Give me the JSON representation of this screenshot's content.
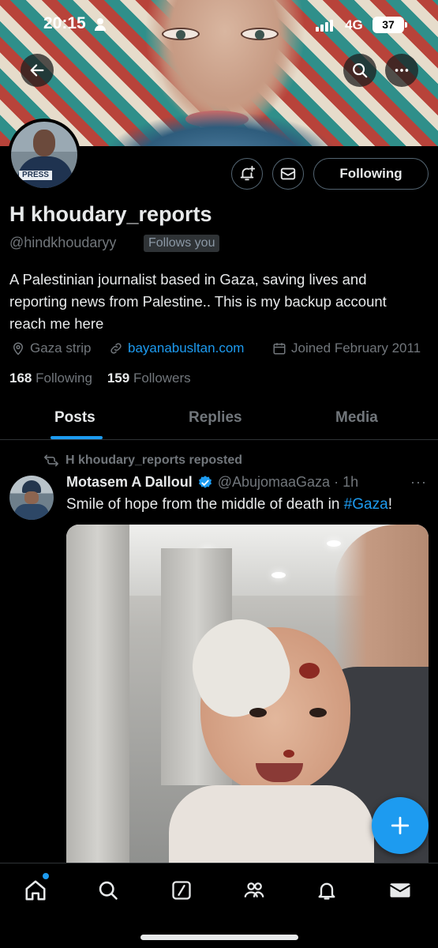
{
  "status_bar": {
    "time": "20:15",
    "network": "4G",
    "battery": "37"
  },
  "profile": {
    "display_name": "H khoudary_reports",
    "handle": "@hindkhoudaryy",
    "follows_you_label": "Follows you",
    "following_button_label": "Following",
    "bio": "A Palestinian journalist based in Gaza, saving lives and reporting news from Palestine.. This is my backup account reach me here",
    "avatar_badge": "PRESS",
    "location": "Gaza strip",
    "website": "bayanabusltan.com",
    "joined": "Joined February 2011",
    "following_count": "168",
    "following_label": "Following",
    "followers_count": "159",
    "followers_label": "Followers"
  },
  "tabs": [
    {
      "label": "Posts",
      "active": true
    },
    {
      "label": "Replies",
      "active": false
    },
    {
      "label": "Media",
      "active": false
    }
  ],
  "tweet": {
    "repost_text": "H khoudary_reports reposted",
    "author_name": "Motasem A Dalloul",
    "author_handle": "@AbujomaaGaza",
    "time": "1h",
    "text_prefix": "Smile of hope from the middle of death in ",
    "hashtag": "#Gaza",
    "text_suffix": "!"
  },
  "colors": {
    "accent": "#1d9bf0",
    "text_primary": "#e7e9ea",
    "text_secondary": "#71767b",
    "border": "#2f3336",
    "background": "#000000"
  },
  "icons": {
    "back": "arrow-left-icon",
    "search": "search-icon",
    "more": "more-dots-icon",
    "notify": "bell-plus-icon",
    "message": "envelope-icon",
    "location": "location-pin-icon",
    "link": "link-icon",
    "calendar": "calendar-icon",
    "repost": "repost-icon",
    "verified": "verified-badge-icon",
    "compose": "plus-icon",
    "nav": [
      "home-icon",
      "search-icon",
      "grok-icon",
      "communities-icon",
      "bell-icon",
      "mail-icon"
    ]
  }
}
